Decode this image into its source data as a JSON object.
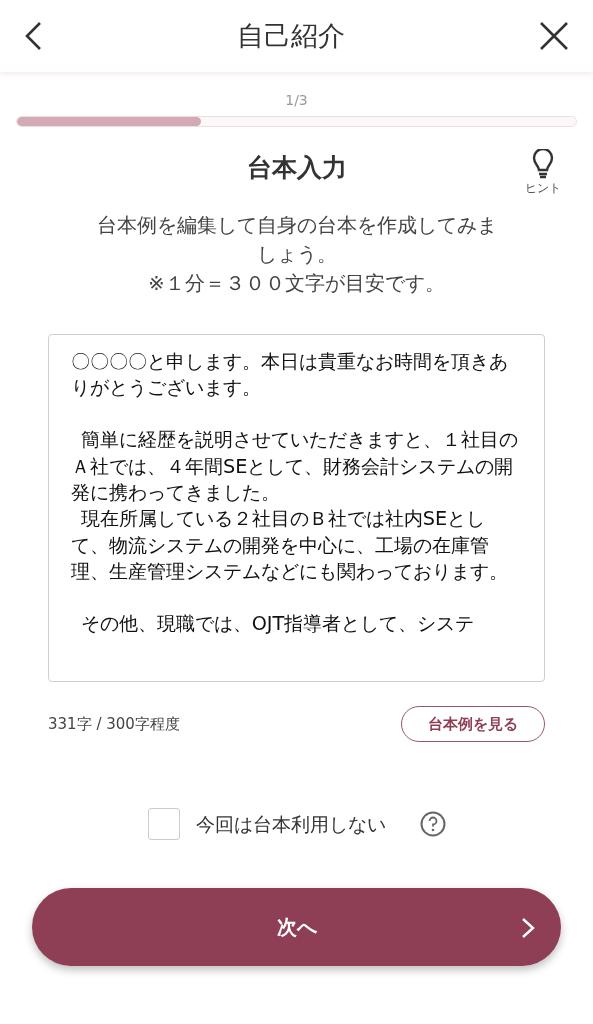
{
  "header": {
    "title": "自己紹介"
  },
  "progress": {
    "step": "1/3",
    "level": 0.33
  },
  "section": {
    "title": "台本入力",
    "hint_label": "ヒント"
  },
  "description": [
    "台本例を編集して自身の台本を作成してみましょう。",
    "※１分＝３００文字が目安です。"
  ],
  "script": {
    "blocks": [
      [
        {
          "text": "〇〇〇〇と申します。本日は貴重なお時間を頂きありがとうございます。",
          "indented": false
        }
      ],
      [
        {
          "text": "簡単に経歴を説明させていただきますと、１社目のＡ社では、４年間SEとして、財務会計システムの開発に携わってきました。",
          "indented": true
        },
        {
          "text": "現在所属している２社目のＢ社では社内SEとして、物流システムの開発を中心に、工場の在庫管理、生産管理システムなどにも関わっております。",
          "indented": true
        }
      ],
      [
        {
          "text": "その他、現職では、OJT指導者として、システ",
          "indented": true
        }
      ]
    ]
  },
  "counter": "331字 / 300字程度",
  "example_button": "台本例を見る",
  "skip_option": {
    "label": "今回は台本利用しない",
    "checked": false
  },
  "next_button": "次へ"
}
